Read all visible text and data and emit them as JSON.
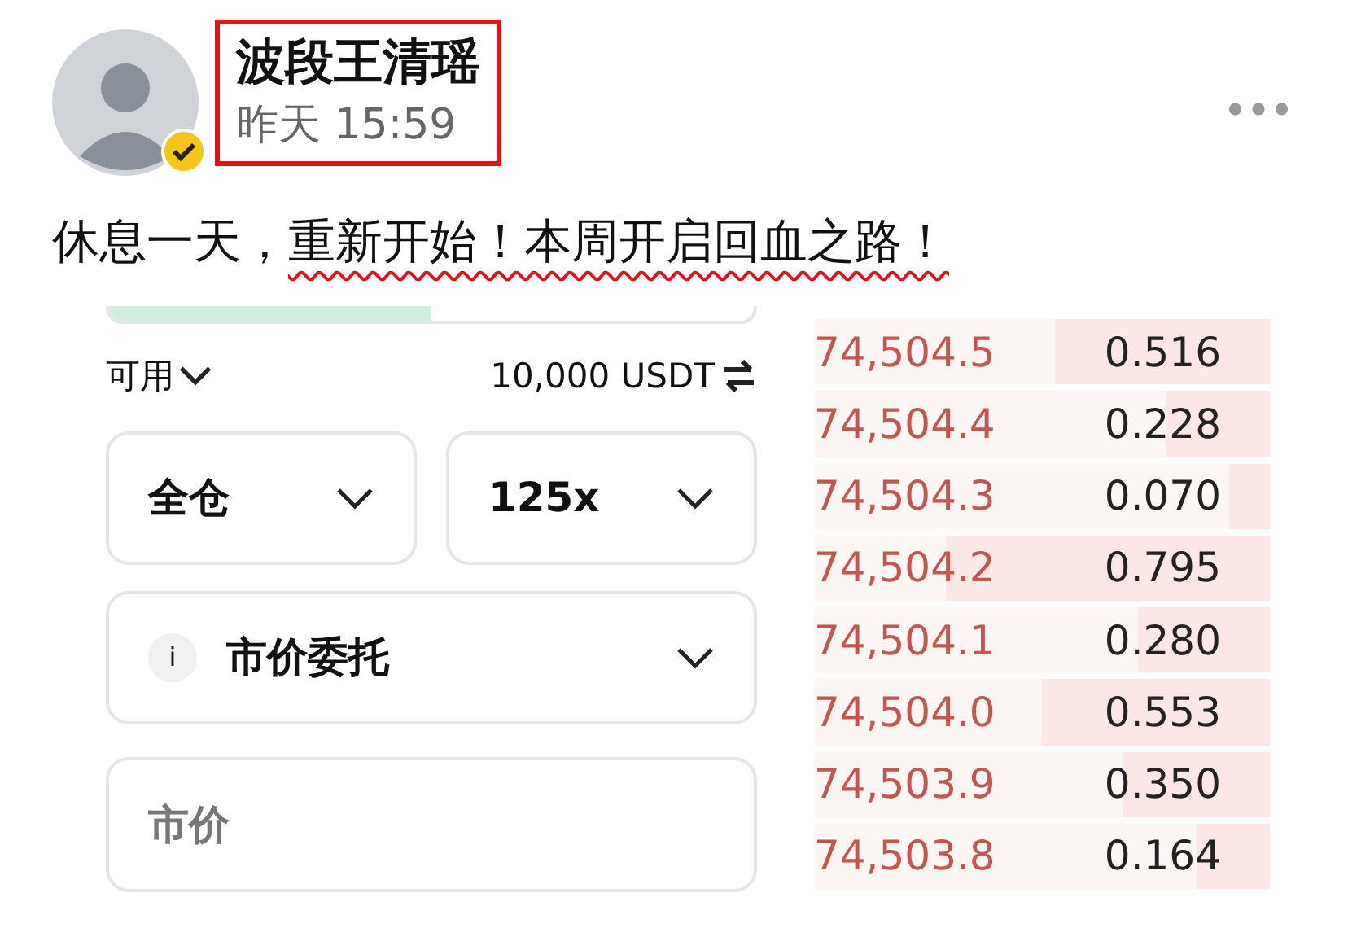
{
  "post": {
    "author": "波段王清瑶",
    "time": "昨天 15:59",
    "author_highlighted": true,
    "verified": true,
    "text_plain": "休息一天，",
    "text_marked": "重新开始！本周开启回血之路！"
  },
  "top_slider": {
    "level": 0.5
  },
  "order_form": {
    "available_label": "可用",
    "balance": "10,000 USDT",
    "margin_mode": "全仓",
    "leverage": "125x",
    "info_mark": "i",
    "order_type": "市价委托",
    "price_placeholder": "市价"
  },
  "order_book": [
    {
      "price": "74,504.5",
      "amount": "0.516",
      "level": 0.47
    },
    {
      "price": "74,504.4",
      "amount": "0.228",
      "level": 0.23
    },
    {
      "price": "74,504.3",
      "amount": "0.070",
      "level": 0.09
    },
    {
      "price": "74,504.2",
      "amount": "0.795",
      "level": 0.71
    },
    {
      "price": "74,504.1",
      "amount": "0.280",
      "level": 0.29
    },
    {
      "price": "74,504.0",
      "amount": "0.553",
      "level": 0.5
    },
    {
      "price": "74,503.9",
      "amount": "0.350",
      "level": 0.32
    },
    {
      "price": "74,503.8",
      "amount": "0.164",
      "level": 0.16
    }
  ]
}
